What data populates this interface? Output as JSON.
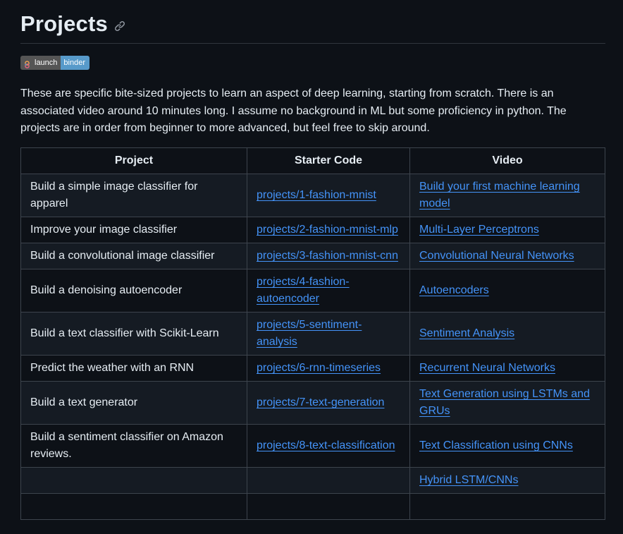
{
  "section": {
    "title": "Projects",
    "anchor_icon": "link-icon"
  },
  "badge": {
    "icon": "binder-logo",
    "left_label": "launch",
    "right_label": "binder",
    "left_color": "#555555",
    "right_color": "#579aca"
  },
  "intro": "These are specific bite-sized projects to learn an aspect of deep learning, starting from scratch. There is an associated video around 10 minutes long. I assume no background in ML but some proficiency in python. The projects are in order from beginner to more advanced, but feel free to skip around.",
  "table": {
    "headers": [
      "Project",
      "Starter Code",
      "Video"
    ],
    "rows": [
      {
        "project": "Build a simple image classifier for apparel",
        "code": "projects/1-fashion-mnist",
        "video": "Build your first machine learning model"
      },
      {
        "project": "Improve your image classifier",
        "code": "projects/2-fashion-mnist-mlp",
        "video": "Multi-Layer Perceptrons"
      },
      {
        "project": "Build a convolutional image classifier",
        "code": "projects/3-fashion-mnist-cnn",
        "video": "Convolutional Neural Networks"
      },
      {
        "project": "Build a denoising autoencoder",
        "code": "projects/4-fashion-autoencoder",
        "video": "Autoencoders"
      },
      {
        "project": "Build a text classifier with Scikit-Learn",
        "code": "projects/5-sentiment-analysis",
        "video": "Sentiment Analysis"
      },
      {
        "project": "Predict the weather with an RNN",
        "code": "projects/6-rnn-timeseries",
        "video": "Recurrent Neural Networks"
      },
      {
        "project": "Build a text generator",
        "code": "projects/7-text-generation",
        "video": "Text Generation using LSTMs and GRUs"
      },
      {
        "project": "Build a sentiment classifier on Amazon reviews.",
        "code": "projects/8-text-classification",
        "video": "Text Classification using CNNs"
      },
      {
        "project": "",
        "code": "",
        "video": "Hybrid LSTM/CNNs"
      },
      {
        "project": "",
        "code": "",
        "video": ""
      }
    ]
  },
  "colors": {
    "background": "#0d1117",
    "text": "#e6edf3",
    "link": "#4493f8",
    "border": "#3d444d",
    "row_alt": "#151b23"
  }
}
